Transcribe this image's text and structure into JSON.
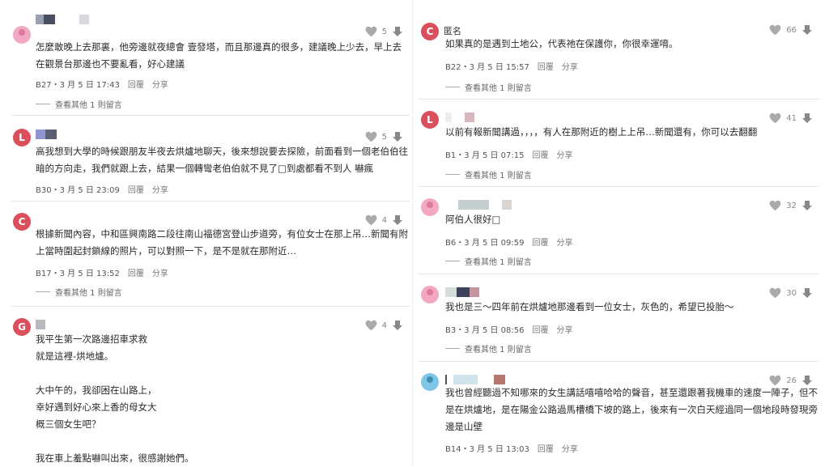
{
  "labels": {
    "reply": "回覆",
    "share": "分享"
  },
  "left": [
    {
      "avatar": "pink",
      "name_text": "",
      "likes": "5",
      "lines": [
        "怎麼敢晚上去那裏，他旁邊就夜總會 壹發塔，而且那邊真的很多，建議晚上少去，早上去",
        "在觀景台那邊也不要亂看，好心建議"
      ],
      "meta": "B27・3 月 5 日 17:43",
      "more": "查看其他 1 則留言"
    },
    {
      "avatar": "letter",
      "letter": "L",
      "name_text": "",
      "likes": "5",
      "lines": [
        "高我想到大學的時候跟朋友半夜去烘爐地聊天，後來想說要去探險，前面看到一個老伯伯往",
        "暗的方向走，我們就跟上去，結果一個轉彎老伯伯就不見了□到處都看不到人 嚇瘋"
      ],
      "meta": "B30・3 月 5 日 23:09",
      "more": ""
    },
    {
      "avatar": "letter",
      "letter": "C",
      "name_text": "",
      "likes": "4",
      "lines": [
        "根據新聞內容，中和區興南路二段往南山福德宮登山步道旁，有位女士在那上吊…新聞有附",
        "上當時圍起封鎖線的照片，可以對照一下，是不是就在那附近…"
      ],
      "meta": "B17・3 月 5 日 13:52",
      "more": "查看其他 1 則留言"
    },
    {
      "avatar": "letter",
      "letter": "G",
      "name_text": "",
      "likes": "4",
      "lines": [
        "我平生第一次路邊招車求救",
        "就是這裡-烘地爐。",
        "",
        "大中午的，我卻困在山路上，",
        "幸好遇到好心來上香的母女大",
        "概三個女生吧？",
        "",
        "我在車上羞點嚇叫出來，很感謝她們。"
      ],
      "meta": "",
      "more": ""
    }
  ],
  "right": [
    {
      "avatar": "letter",
      "letter": "C",
      "name_text": "匿名",
      "likes": "66",
      "lines": [
        "如果真的是遇到土地公，代表祂在保護你，你很幸運唷。"
      ],
      "meta": "B22・3 月 5 日 15:57",
      "more": "查看其他 1 則留言"
    },
    {
      "avatar": "letter",
      "letter": "L",
      "name_text": "",
      "likes": "41",
      "lines": [
        "以前有報新聞講過，，，，有人在那附近的樹上上吊…新聞還有，你可以去翻翻"
      ],
      "meta": "B1・3 月 5 日 07:15",
      "more": "查看其他 1 則留言"
    },
    {
      "avatar": "pink",
      "name_text": "",
      "likes": "32",
      "lines": [
        "阿伯人很好□"
      ],
      "meta": "B6・3 月 5 日 09:59",
      "more": "查看其他 1 則留言"
    },
    {
      "avatar": "pink",
      "name_text": "",
      "likes": "30",
      "lines": [
        "我也是三～四年前在烘爐地那邊看到一位女士，灰色的，希望已投胎～"
      ],
      "meta": "B3・3 月 5 日 08:56",
      "more": "查看其他 1 則留言"
    },
    {
      "avatar": "blue",
      "name_text": "",
      "likes": "26",
      "lines": [
        "我也曾經聽過不知哪來的女生講話嘻嘻哈哈的聲音，甚至還跟著我機車的速度一陣子，但不",
        "是在烘爐地，是在陽金公路過馬槽橋下坡的路上，後來有一次白天經過同一個地段時發現旁",
        "邊是山壁"
      ],
      "meta": "B14・3 月 5 日 13:03",
      "more": ""
    }
  ],
  "colors": {
    "accent_letter_avatar": "#d94f5b",
    "pink_avatar": "#f2a7c3",
    "blue_avatar": "#7dc6e6"
  }
}
